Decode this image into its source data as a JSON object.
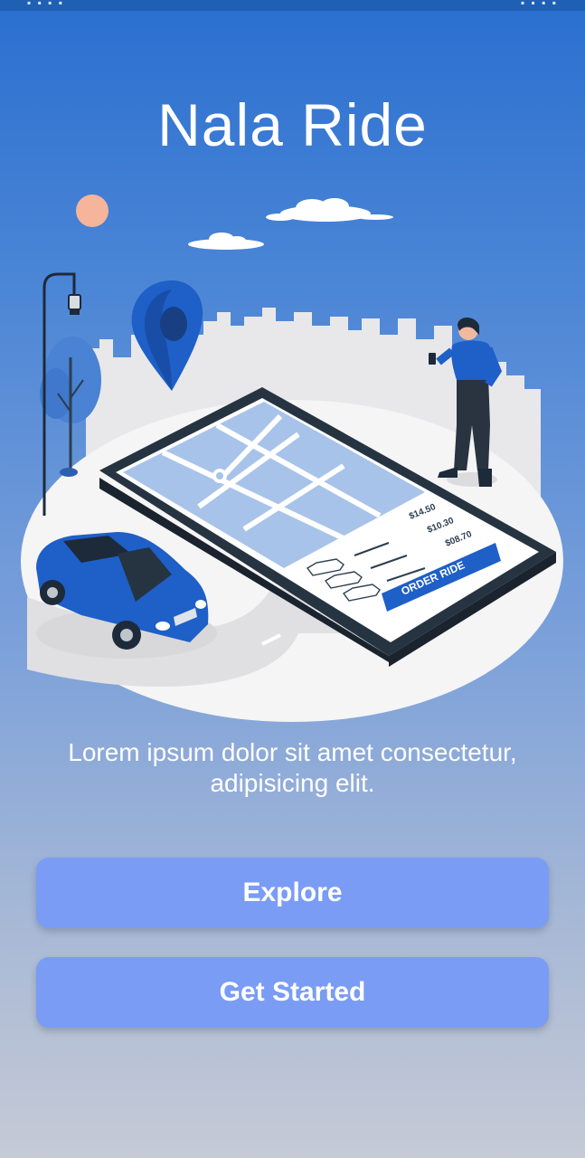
{
  "status_bar": {
    "left_icons": "▪ ▪ ▪ ▪",
    "right_icons": "▪ ▪ ▪ ▪"
  },
  "app": {
    "title": "Nala Ride"
  },
  "illustration": {
    "prices": [
      "$14.50",
      "$10.30",
      "$08.70"
    ],
    "order_button_label": "ORDER RIDE",
    "colors": {
      "primary": "#1e5fc8",
      "map": "#a8c3ea",
      "ground": "#f2f2f2"
    }
  },
  "description": "Lorem ipsum dolor sit amet consectetur, adipisicing elit.",
  "buttons": {
    "explore": "Explore",
    "get_started": "Get Started"
  }
}
